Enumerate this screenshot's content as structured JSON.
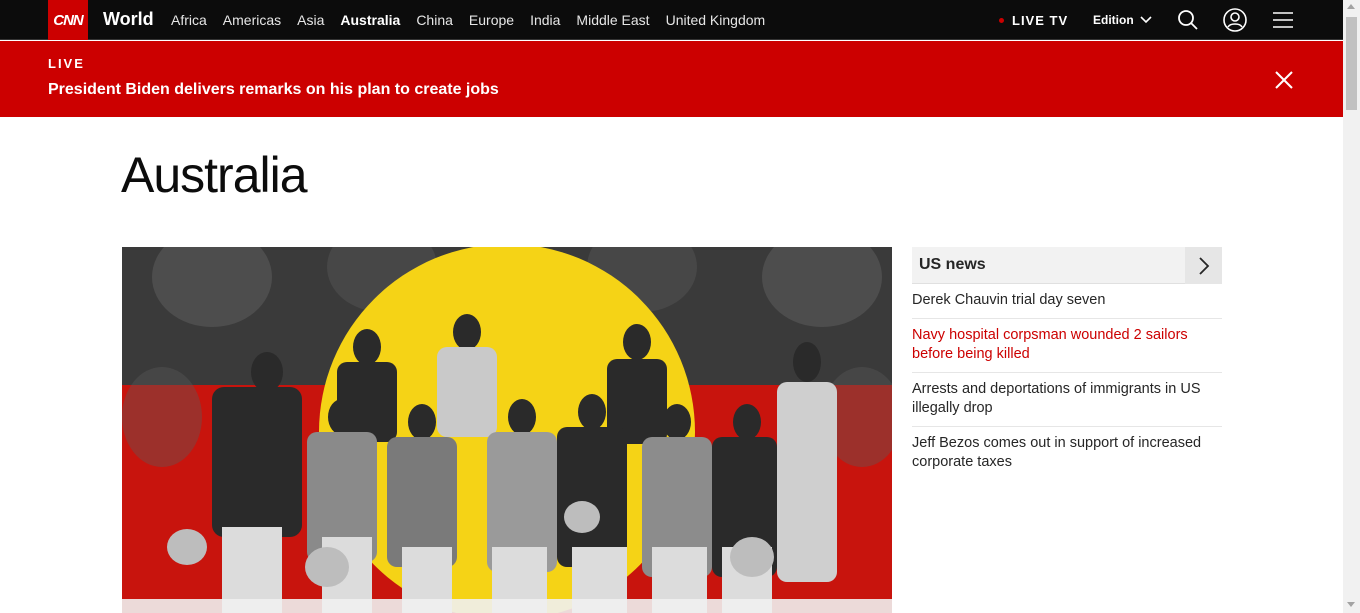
{
  "nav": {
    "logo": "CNN",
    "section": "World",
    "links": [
      {
        "label": "Africa",
        "active": false
      },
      {
        "label": "Americas",
        "active": false
      },
      {
        "label": "Asia",
        "active": false
      },
      {
        "label": "Australia",
        "active": true
      },
      {
        "label": "China",
        "active": false
      },
      {
        "label": "Europe",
        "active": false
      },
      {
        "label": "India",
        "active": false
      },
      {
        "label": "Middle East",
        "active": false
      },
      {
        "label": "United Kingdom",
        "active": false
      }
    ],
    "live_tv": "LIVE TV",
    "edition": "Edition",
    "icons": [
      "search-icon",
      "account-icon",
      "menu-icon"
    ]
  },
  "banner": {
    "label": "LIVE",
    "headline": "President Biden delivers remarks on his plan to create jobs",
    "close_icon": "close-icon"
  },
  "page": {
    "title": "Australia"
  },
  "sidebar": {
    "title": "US news",
    "items": [
      {
        "text": "Derek Chauvin trial day seven",
        "highlight": false
      },
      {
        "text": "Navy hospital corpsman wounded 2 sailors before being killed",
        "highlight": true
      },
      {
        "text": "Arrests and deportations of immigrants in US illegally drop",
        "highlight": false
      },
      {
        "text": "Jeff Bezos comes out in support of increased corporate taxes",
        "highlight": false
      }
    ]
  },
  "colors": {
    "brand_red": "#cc0000",
    "nav_bg": "#0c0c0c",
    "flag_yellow": "#f5d316"
  }
}
